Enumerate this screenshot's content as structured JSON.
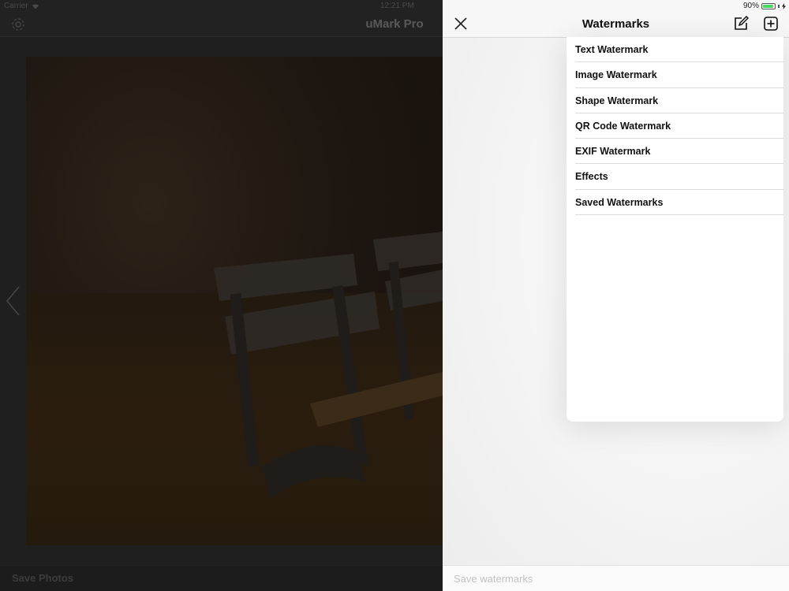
{
  "status_bar": {
    "carrier": "Carrier",
    "time": "12:21 PM",
    "battery": "90%",
    "battery_level": 0.9
  },
  "app": {
    "title": "uMark Pro",
    "save_photos_label": "Save Photos"
  },
  "panel": {
    "title": "Watermarks",
    "menu_items": [
      {
        "label": "Text Watermark"
      },
      {
        "label": "Image Watermark"
      },
      {
        "label": "Shape Watermark"
      },
      {
        "label": "QR Code Watermark"
      },
      {
        "label": "EXIF Watermark"
      },
      {
        "label": "Effects"
      },
      {
        "label": "Saved Watermarks"
      }
    ],
    "save_watermarks_label": "Save watermarks"
  },
  "icons": {
    "close": "close-icon",
    "edit": "edit-icon",
    "add": "add-icon",
    "settings": "gear-icon",
    "back": "chevron-left-icon"
  },
  "colors": {
    "battery_green": "#4cd964",
    "panel_bg": "#f7f7f7",
    "text_dark": "#111111"
  }
}
